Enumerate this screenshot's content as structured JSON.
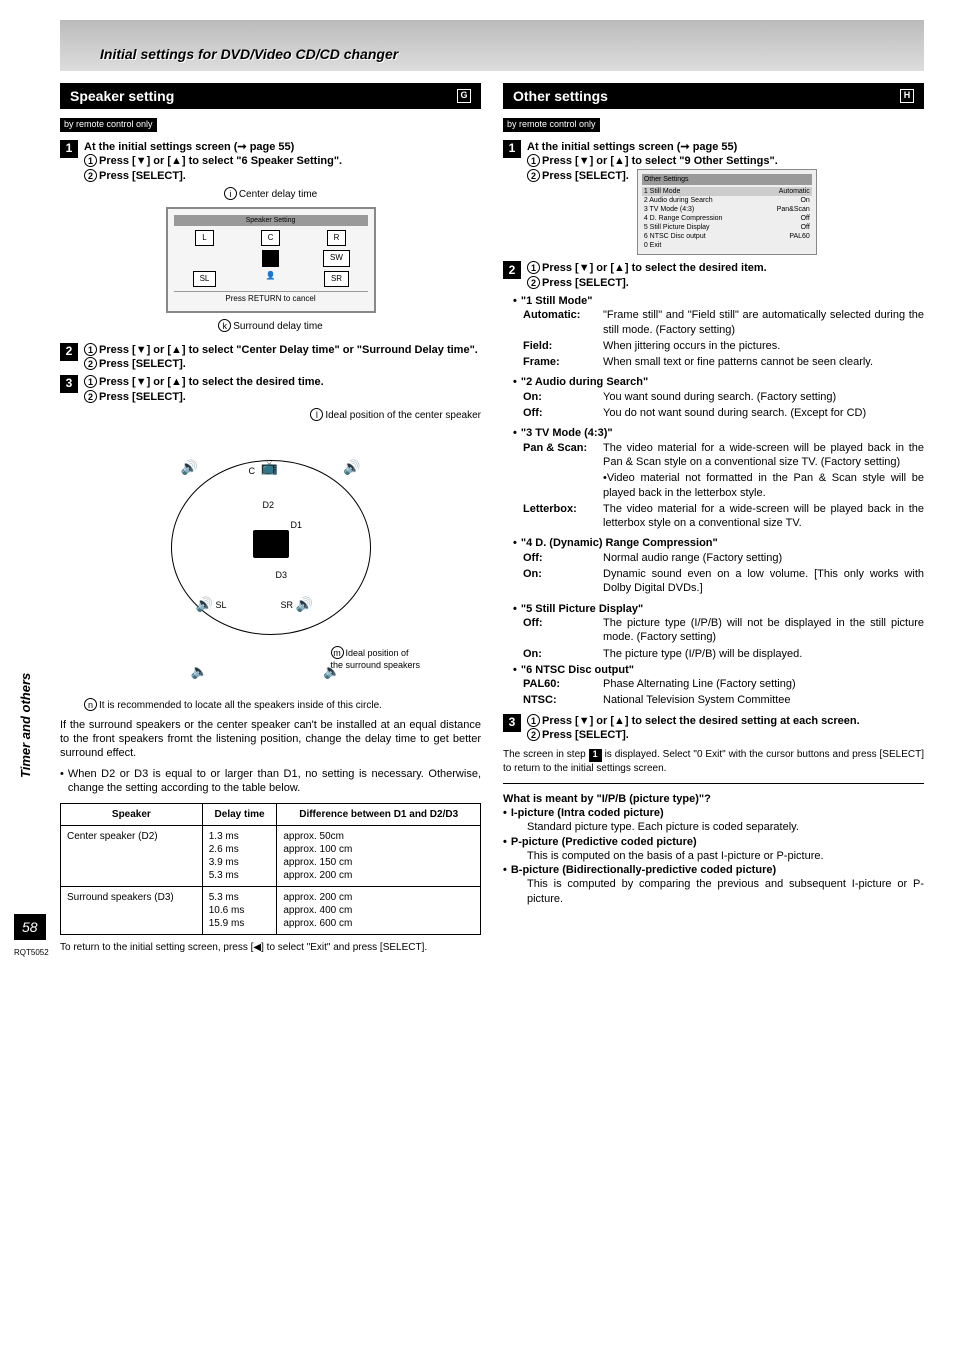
{
  "banner": "Initial settings for DVD/Video CD/CD changer",
  "sidebar": {
    "label": "Timer and others",
    "page": "58",
    "rqt": "RQT5052"
  },
  "left": {
    "title": "Speaker setting",
    "badge": "G",
    "remote": "by remote control only",
    "step1_intro": "At the initial settings screen (➞ page 55)",
    "step1_a": "Press [▼] or [▲] to select \"6 Speaker Setting\".",
    "step1_b": "Press [SELECT].",
    "label_center_delay": "Center delay time",
    "label_surround_delay": "Surround delay time",
    "osd_title": "Speaker Setting",
    "osd_labels": [
      "L",
      "C",
      "R",
      "SW",
      "SL",
      "SR"
    ],
    "osd_return": "Press RETURN to cancel",
    "step2_a": "Press [▼] or [▲]  to select \"Center Delay time\" or \"Surround Delay time\".",
    "step2_b": "Press [SELECT].",
    "step3_a": "Press [▼] or [▲] to select the desired time.",
    "step3_b": "Press [SELECT].",
    "diag_ideal_center": "Ideal position of the center speaker",
    "diag_ideal_surround": "Ideal position of the surround speakers",
    "diag_recommend": "It is recommended to locate all the speakers inside of this circle.",
    "diag_labels": {
      "c": "C",
      "sl": "SL",
      "sr": "SR",
      "d1": "D1",
      "d2": "D2",
      "d3": "D3"
    },
    "para1": "If the surround speakers or the center speaker can't be installed at an equal distance to the front speakers fromt the listening position, change the delay time to get better surround effect.",
    "para2": "When D2 or D3 is equal to or larger than D1, no setting is necessary. Otherwise, change the setting according to the table below.",
    "table": {
      "h1": "Speaker",
      "h2": "Delay time",
      "h3": "Difference between D1 and D2/D3",
      "rows": [
        {
          "sp": "Center speaker (D2)",
          "delays": [
            "1.3 ms",
            "2.6 ms",
            "3.9 ms",
            "5.3 ms"
          ],
          "diffs": [
            "approx.  50cm",
            "approx. 100 cm",
            "approx. 150 cm",
            "approx. 200 cm"
          ]
        },
        {
          "sp": "Surround speakers (D3)",
          "delays": [
            "5.3 ms",
            "10.6 ms",
            "15.9 ms"
          ],
          "diffs": [
            "approx. 200 cm",
            "approx. 400 cm",
            "approx. 600 cm"
          ]
        }
      ]
    },
    "return_note": "To return to the initial setting screen, press [◀] to select \"Exit\" and press [SELECT]."
  },
  "right": {
    "title": "Other settings",
    "badge": "H",
    "remote": "by remote control only",
    "step1_intro": "At the initial settings screen (➞ page 55)",
    "step1_a": "Press [▼] or [▲] to select \"9 Other Settings\".",
    "step1_b": "Press [SELECT].",
    "osd_rows": [
      {
        "k": "1 Still Mode",
        "v": "Automatic"
      },
      {
        "k": "2 Audio during Search",
        "v": "On"
      },
      {
        "k": "3 TV Mode (4:3)",
        "v": "Pan&Scan"
      },
      {
        "k": "4 D. Range Compression",
        "v": "Off"
      },
      {
        "k": "5 Still Picture Display",
        "v": "Off"
      },
      {
        "k": "6 NTSC Disc output",
        "v": "PAL60"
      },
      {
        "k": "0 Exit",
        "v": ""
      }
    ],
    "step2_a": "Press [▼] or [▲] to select the desired item.",
    "step2_b": "Press [SELECT].",
    "items": [
      {
        "head": "\"1 Still Mode\"",
        "opts": [
          {
            "k": "Automatic:",
            "v": "\"Frame still\" and \"Field still\" are automatically selected during the still mode. (Factory setting)"
          },
          {
            "k": "Field:",
            "v": "When jittering occurs in the pictures."
          },
          {
            "k": "Frame:",
            "v": "When small text or fine patterns cannot be seen clearly."
          }
        ]
      },
      {
        "head": "\"2 Audio during Search\"",
        "opts": [
          {
            "k": "On:",
            "v": "You want sound during search. (Factory setting)"
          },
          {
            "k": "Off:",
            "v": "You do not want sound during search. (Except for CD)"
          }
        ]
      },
      {
        "head": "\"3 TV Mode (4:3)\"",
        "opts": [
          {
            "k": "Pan & Scan:",
            "v": "The video material for a wide-screen will be played back in the Pan & Scan style on a conventional size TV. (Factory setting)"
          },
          {
            "k": "",
            "v": "•Video material not formatted in the Pan & Scan style will be played back in the letterbox style."
          },
          {
            "k": "Letterbox:",
            "v": "The video material for a wide-screen will be played back in the letterbox style on a conventional size TV."
          }
        ]
      },
      {
        "head": "\"4 D. (Dynamic) Range Compression\"",
        "opts": [
          {
            "k": "Off:",
            "v": "Normal audio range (Factory setting)"
          },
          {
            "k": "On:",
            "v": "Dynamic sound even on a low volume. [This only works with Dolby Digital DVDs.]"
          }
        ]
      },
      {
        "head": "\"5 Still Picture Display\"",
        "opts": [
          {
            "k": "Off:",
            "v": "The picture type (I/P/B) will not be displayed in the still picture mode. (Factory setting)"
          },
          {
            "k": "On:",
            "v": "The picture type (I/P/B) will be displayed."
          }
        ]
      },
      {
        "head": "\"6 NTSC Disc output\"",
        "opts": [
          {
            "k": "PAL60:",
            "v": "Phase Alternating Line (Factory setting)"
          },
          {
            "k": "NTSC:",
            "v": "National Television System Committee"
          }
        ]
      }
    ],
    "step3_a": "Press [▼] or [▲] to select the desired setting at each screen.",
    "step3_b": "Press [SELECT].",
    "return_note_a": "The screen in step ",
    "return_note_b": " is displayed. Select \"0 Exit\" with the cursor buttons and press [SELECT] to return to the initial settings screen.",
    "ipb": {
      "q": "What is meant by \"I/P/B (picture type)\"?",
      "i_h": "I-picture (Intra coded picture)",
      "i_d": "Standard picture type. Each picture is coded separately.",
      "p_h": "P-picture (Predictive coded picture)",
      "p_d": "This is computed on the basis of a past I-picture or P-picture.",
      "b_h": "B-picture (Bidirectionally-predictive coded picture)",
      "b_d": "This is computed by comparing the previous and subsequent I-picture or P-picture."
    }
  },
  "chart_data": {
    "type": "table",
    "title": "Speaker delay time vs. distance difference",
    "columns": [
      "Speaker",
      "Delay time",
      "Difference between D1 and D2/D3"
    ],
    "rows": [
      [
        "Center speaker (D2)",
        "1.3 ms",
        "approx. 50 cm"
      ],
      [
        "Center speaker (D2)",
        "2.6 ms",
        "approx. 100 cm"
      ],
      [
        "Center speaker (D2)",
        "3.9 ms",
        "approx. 150 cm"
      ],
      [
        "Center speaker (D2)",
        "5.3 ms",
        "approx. 200 cm"
      ],
      [
        "Surround speakers (D3)",
        "5.3 ms",
        "approx. 200 cm"
      ],
      [
        "Surround speakers (D3)",
        "10.6 ms",
        "approx. 400 cm"
      ],
      [
        "Surround speakers (D3)",
        "15.9 ms",
        "approx. 600 cm"
      ]
    ]
  }
}
